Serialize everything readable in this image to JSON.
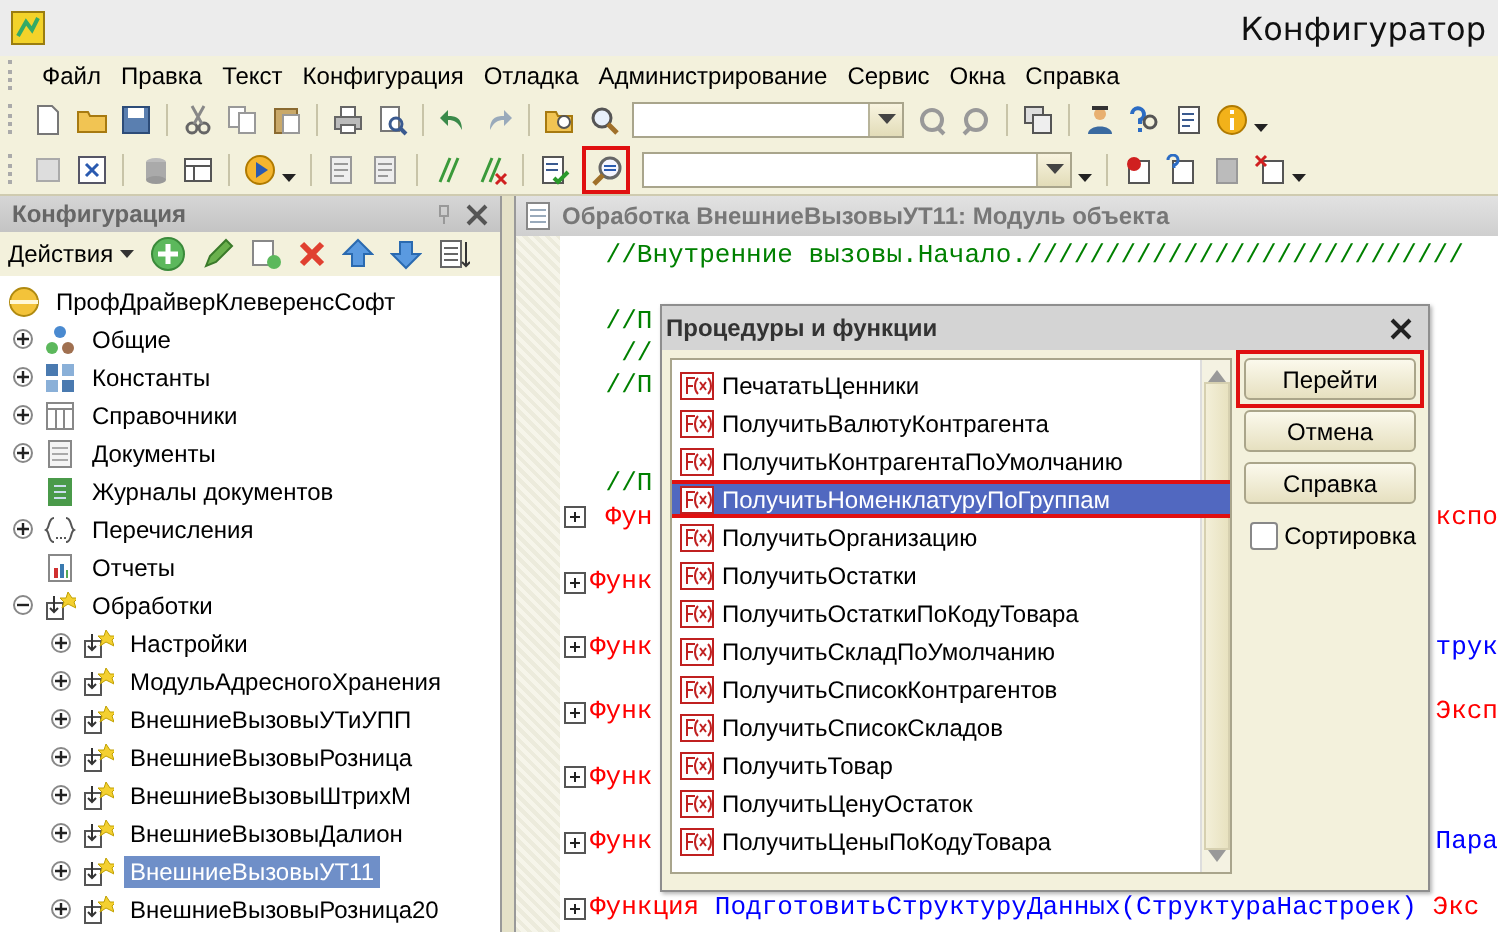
{
  "window": {
    "title": "Конфигуратор"
  },
  "menu": [
    "Файл",
    "Правка",
    "Текст",
    "Конфигурация",
    "Отладка",
    "Администрирование",
    "Сервис",
    "Окна",
    "Справка"
  ],
  "procedures_button": {
    "highlighted": true
  },
  "config_panel": {
    "title": "Конфигурация",
    "actions_label": "Действия",
    "tree": [
      {
        "label": "ПрофДрайверКлеверенсСофт",
        "kind": "root",
        "selected": false,
        "children": [
          {
            "label": "Общие",
            "kind": "common",
            "expandable": true,
            "expanded": false,
            "selected": false
          },
          {
            "label": "Константы",
            "kind": "constants",
            "expandable": true,
            "expanded": false,
            "selected": false
          },
          {
            "label": "Справочники",
            "kind": "catalog",
            "expandable": true,
            "expanded": false,
            "selected": false
          },
          {
            "label": "Документы",
            "kind": "document",
            "expandable": true,
            "expanded": false,
            "selected": false
          },
          {
            "label": "Журналы документов",
            "kind": "journal",
            "expandable": false,
            "selected": false
          },
          {
            "label": "Перечисления",
            "kind": "enum",
            "expandable": true,
            "expanded": false,
            "selected": false
          },
          {
            "label": "Отчеты",
            "kind": "report",
            "expandable": false,
            "selected": false
          },
          {
            "label": "Обработки",
            "kind": "processing",
            "expandable": true,
            "expanded": true,
            "selected": false,
            "children": [
              {
                "label": "Настройки",
                "kind": "processing",
                "expandable": true,
                "expanded": false,
                "selected": false
              },
              {
                "label": "МодульАдресногоХранения",
                "kind": "processing",
                "expandable": true,
                "expanded": false,
                "selected": false
              },
              {
                "label": "ВнешниеВызовыУТиУПП",
                "kind": "processing",
                "expandable": true,
                "expanded": false,
                "selected": false
              },
              {
                "label": "ВнешниеВызовыРозница",
                "kind": "processing",
                "expandable": true,
                "expanded": false,
                "selected": false
              },
              {
                "label": "ВнешниеВызовыШтрихМ",
                "kind": "processing",
                "expandable": true,
                "expanded": false,
                "selected": false
              },
              {
                "label": "ВнешниеВызовыДалион",
                "kind": "processing",
                "expandable": true,
                "expanded": false,
                "selected": false
              },
              {
                "label": "ВнешниеВызовыУТ11",
                "kind": "processing",
                "expandable": true,
                "expanded": false,
                "selected": true
              },
              {
                "label": "ВнешниеВызовыРозница20",
                "kind": "processing",
                "expandable": true,
                "expanded": false,
                "selected": false
              }
            ]
          }
        ]
      }
    ]
  },
  "editor": {
    "title": "Обработка ВнешниеВызовыУТ11: Модуль объекта",
    "lines": [
      {
        "kind": "code",
        "left": [
          {
            "kind": "comment",
            "text": " //Внутренние вызовы.Начало.////////////////////////////"
          }
        ]
      },
      {
        "kind": "blank"
      },
      {
        "kind": "code",
        "left": [
          {
            "kind": "comment",
            "text": " //П"
          }
        ]
      },
      {
        "kind": "code",
        "left": [
          {
            "kind": "comment",
            "text": "  //"
          }
        ]
      },
      {
        "kind": "code",
        "left": [
          {
            "kind": "comment",
            "text": " //П"
          }
        ]
      },
      {
        "kind": "blank"
      },
      {
        "kind": "blank"
      },
      {
        "kind": "code",
        "left": [
          {
            "kind": "comment",
            "text": " //П"
          }
        ]
      },
      {
        "kind": "code",
        "fold": true,
        "left": [
          {
            "kind": "keyword",
            "text": " Фун"
          }
        ],
        "right": [
          {
            "kind": "keyword",
            "text": "кспо"
          }
        ]
      },
      {
        "kind": "blank"
      },
      {
        "kind": "code",
        "fold": true,
        "left": [
          {
            "kind": "keyword",
            "text": "Функ"
          }
        ]
      },
      {
        "kind": "blank"
      },
      {
        "kind": "code",
        "fold": true,
        "left": [
          {
            "kind": "keyword",
            "text": "Функ"
          }
        ],
        "right": [
          {
            "kind": "identifier",
            "text": "трук"
          }
        ]
      },
      {
        "kind": "blank"
      },
      {
        "kind": "code",
        "fold": true,
        "left": [
          {
            "kind": "keyword",
            "text": "Функ"
          }
        ],
        "right": [
          {
            "kind": "keyword",
            "text": "Эксп"
          }
        ]
      },
      {
        "kind": "blank"
      },
      {
        "kind": "code",
        "fold": true,
        "left": [
          {
            "kind": "keyword",
            "text": "Функ"
          }
        ]
      },
      {
        "kind": "blank"
      },
      {
        "kind": "code",
        "fold": true,
        "left": [
          {
            "kind": "keyword",
            "text": "Функ"
          }
        ],
        "right": [
          {
            "kind": "identifier",
            "text": "Пара"
          }
        ]
      },
      {
        "kind": "blank"
      },
      {
        "kind": "code",
        "fold": true,
        "left": [
          {
            "kind": "keyword",
            "text": "Функция "
          },
          {
            "kind": "identifier",
            "text": "ПодготовитьСтруктуруДанных(СтруктураНастроек) "
          },
          {
            "kind": "keyword",
            "text": "Экс"
          }
        ]
      }
    ]
  },
  "dialog": {
    "title": "Процедуры и функции",
    "items": [
      {
        "label": "ПечататьЦенники",
        "selected": false,
        "highlighted": false
      },
      {
        "label": "ПолучитьВалютуКонтрагента",
        "selected": false,
        "highlighted": false
      },
      {
        "label": "ПолучитьКонтрагентаПоУмолчанию",
        "selected": false,
        "highlighted": false
      },
      {
        "label": "ПолучитьНоменклатуруПоГруппам",
        "selected": true,
        "highlighted": true
      },
      {
        "label": "ПолучитьОрганизацию",
        "selected": false,
        "highlighted": false
      },
      {
        "label": "ПолучитьОстатки",
        "selected": false,
        "highlighted": false
      },
      {
        "label": "ПолучитьОстаткиПоКодуТовара",
        "selected": false,
        "highlighted": false
      },
      {
        "label": "ПолучитьСкладПоУмолчанию",
        "selected": false,
        "highlighted": false
      },
      {
        "label": "ПолучитьСписокКонтрагентов",
        "selected": false,
        "highlighted": false
      },
      {
        "label": "ПолучитьСписокСкладов",
        "selected": false,
        "highlighted": false
      },
      {
        "label": "ПолучитьТовар",
        "selected": false,
        "highlighted": false
      },
      {
        "label": "ПолучитьЦенуОстаток",
        "selected": false,
        "highlighted": false
      },
      {
        "label": "ПолучитьЦеныПоКодуТовара",
        "selected": false,
        "highlighted": false
      }
    ],
    "buttons": [
      {
        "label": "Перейти",
        "highlighted": true
      },
      {
        "label": "Отмена",
        "highlighted": false
      },
      {
        "label": "Справка",
        "highlighted": false
      }
    ],
    "sort_checkbox": {
      "label": "Сортировка",
      "checked": false
    }
  }
}
